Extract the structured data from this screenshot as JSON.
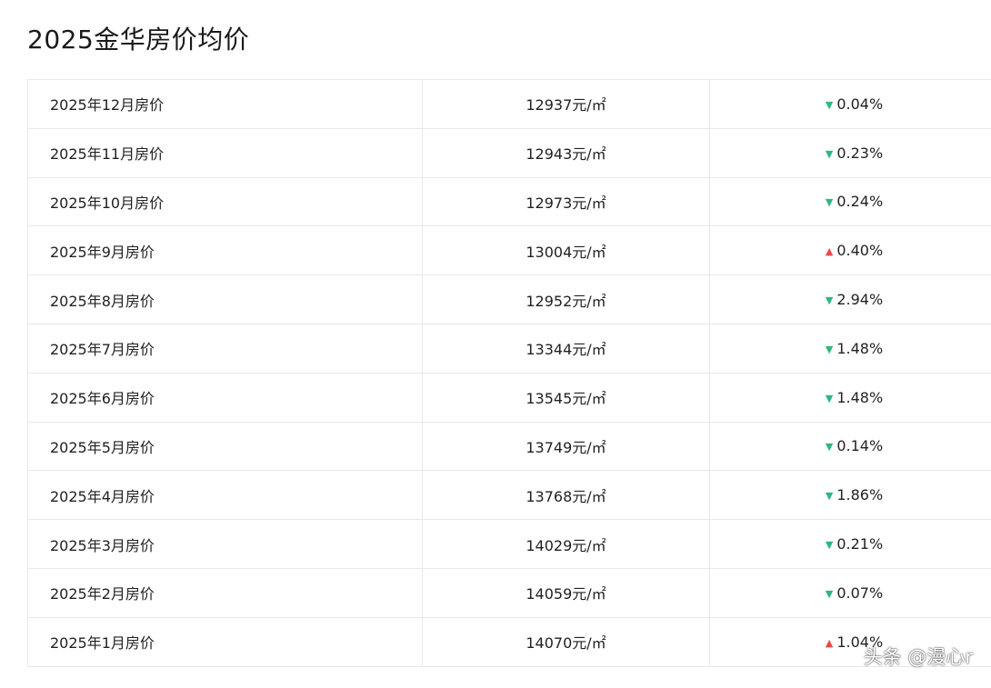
{
  "page": {
    "title": "2025金华房价均价"
  },
  "colors": {
    "down": "#2db87d",
    "up": "#ef4747",
    "border": "#e8e8e8"
  },
  "rows": [
    {
      "month": "2025年12月房价",
      "price": "12937元/㎡",
      "direction": "down",
      "change": "0.04%"
    },
    {
      "month": "2025年11月房价",
      "price": "12943元/㎡",
      "direction": "down",
      "change": "0.23%"
    },
    {
      "month": "2025年10月房价",
      "price": "12973元/㎡",
      "direction": "down",
      "change": "0.24%"
    },
    {
      "month": "2025年9月房价",
      "price": "13004元/㎡",
      "direction": "up",
      "change": "0.40%"
    },
    {
      "month": "2025年8月房价",
      "price": "12952元/㎡",
      "direction": "down",
      "change": "2.94%"
    },
    {
      "month": "2025年7月房价",
      "price": "13344元/㎡",
      "direction": "down",
      "change": "1.48%"
    },
    {
      "month": "2025年6月房价",
      "price": "13545元/㎡",
      "direction": "down",
      "change": "1.48%"
    },
    {
      "month": "2025年5月房价",
      "price": "13749元/㎡",
      "direction": "down",
      "change": "0.14%"
    },
    {
      "month": "2025年4月房价",
      "price": "13768元/㎡",
      "direction": "down",
      "change": "1.86%"
    },
    {
      "month": "2025年3月房价",
      "price": "14029元/㎡",
      "direction": "down",
      "change": "0.21%"
    },
    {
      "month": "2025年2月房价",
      "price": "14059元/㎡",
      "direction": "down",
      "change": "0.07%"
    },
    {
      "month": "2025年1月房价",
      "price": "14070元/㎡",
      "direction": "up",
      "change": "1.04%"
    }
  ],
  "icons": {
    "down": "▼",
    "up": "▲"
  },
  "watermark": "头条 @漫心r"
}
